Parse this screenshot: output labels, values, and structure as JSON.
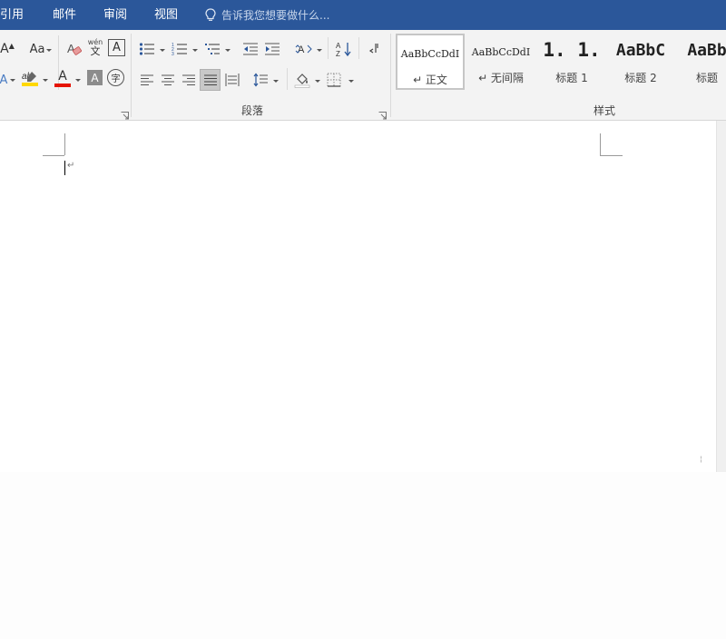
{
  "menu": {
    "tabs": [
      {
        "label": "引用"
      },
      {
        "label": "邮件"
      },
      {
        "label": "审阅"
      },
      {
        "label": "视图"
      }
    ],
    "tell_me_placeholder": "告诉我您想要做什么..."
  },
  "ribbon": {
    "font": {
      "change_case_label": "Aa",
      "grow_font_label": "A",
      "phonetic_top": "wén",
      "phonetic_bottom": "文",
      "border_char": "A",
      "font_color_label": "A",
      "shading_label": "A",
      "enclose_label": "字"
    },
    "paragraph": {
      "label": "段落"
    },
    "styles": {
      "label": "样式",
      "items": [
        {
          "preview": "AaBbCcDdI",
          "name": "↵ 正文",
          "selected": true
        },
        {
          "preview": "AaBbCcDdI",
          "name": "↵ 无间隔",
          "selected": false
        },
        {
          "preview": "1. 1.",
          "name": "标题 1",
          "selected": false
        },
        {
          "preview": "AaBbC",
          "name": "标题 2",
          "selected": false
        },
        {
          "preview": "AaBb",
          "name": "标题",
          "selected": false
        }
      ]
    }
  },
  "document": {
    "paragraph_mark": "↵",
    "page_break_mark": "¦"
  },
  "colors": {
    "accent": "#2b579a",
    "font_color_underline": "#e51400",
    "highlight_underline": "#ffd800"
  }
}
